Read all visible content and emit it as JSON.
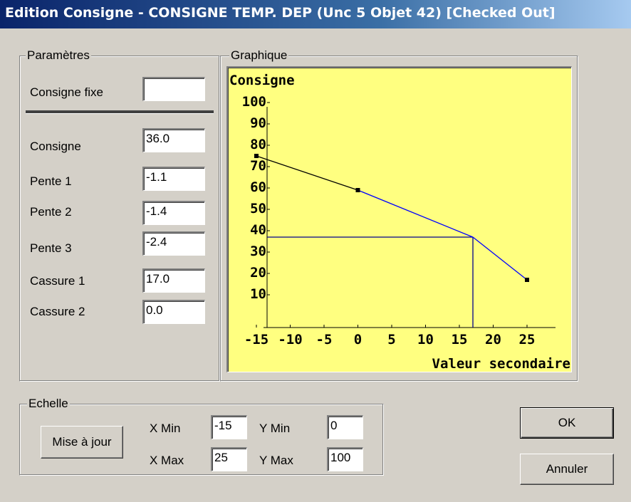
{
  "window": {
    "title": "Edition Consigne - CONSIGNE TEMP. DEP (Unc 5 Objet 42) [Checked Out]"
  },
  "parametres": {
    "legend": "Paramètres",
    "consigne_fixe_label": "Consigne fixe",
    "consigne_fixe_value": "",
    "consigne_label": "Consigne",
    "consigne_value": "36.0",
    "pente1_label": "Pente 1",
    "pente1_value": "-1.1",
    "pente2_label": "Pente 2",
    "pente2_value": "-1.4",
    "pente3_label": "Pente 3",
    "pente3_value": "-2.4",
    "cassure1_label": "Cassure 1",
    "cassure1_value": "17.0",
    "cassure2_label": "Cassure 2",
    "cassure2_value": "0.0"
  },
  "graphique": {
    "legend": "Graphique"
  },
  "chart_data": {
    "type": "line",
    "ylabel": "Consigne",
    "xlabel": "Valeur secondaire",
    "x_ticks": [
      "-15",
      "-10",
      "-5",
      "0",
      "5",
      "10",
      "15",
      "20",
      "25"
    ],
    "y_ticks": [
      "10",
      "20",
      "30",
      "40",
      "50",
      "60",
      "70",
      "80",
      "90",
      "100"
    ],
    "xlim": [
      -15,
      25
    ],
    "ylim": [
      0,
      100
    ],
    "series": [
      {
        "x": [
          -15,
          0,
          17,
          25
        ],
        "y": [
          75,
          59,
          37,
          17
        ]
      }
    ],
    "marker_points": [
      {
        "x": -15,
        "y": 75
      },
      {
        "x": 0,
        "y": 59
      },
      {
        "x": 25,
        "y": 17
      }
    ],
    "break_point": {
      "x": 17,
      "y": 37
    },
    "colors": {
      "background": "#ffff80",
      "segment_1": "#000000",
      "segment_2": "#0000ff",
      "guides": "#00008b"
    }
  },
  "echelle": {
    "legend": "Echelle",
    "update_button": "Mise à jour",
    "xmin_label": "X Min",
    "xmin_value": "-15",
    "xmax_label": "X Max",
    "xmax_value": "25",
    "ymin_label": "Y Min",
    "ymin_value": "0",
    "ymax_label": "Y Max",
    "ymax_value": "100"
  },
  "buttons": {
    "ok": "OK",
    "cancel": "Annuler"
  }
}
